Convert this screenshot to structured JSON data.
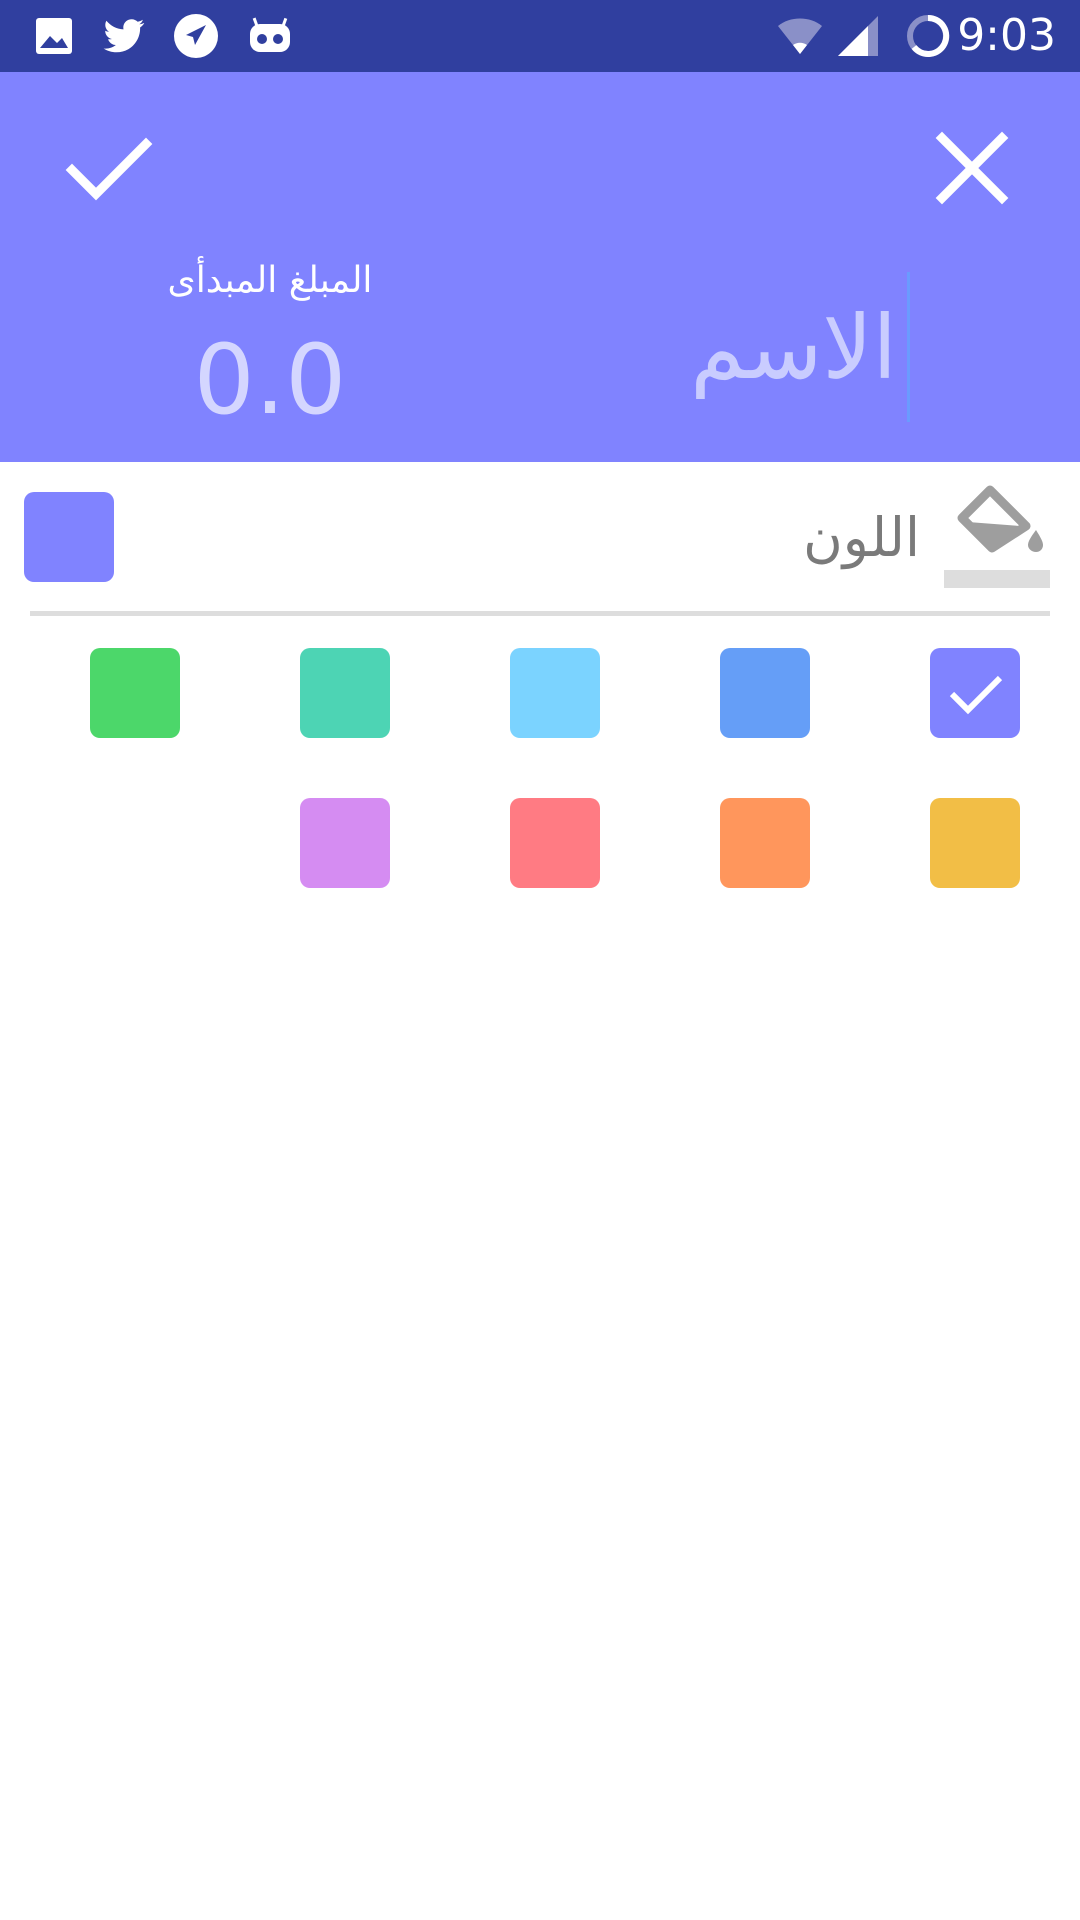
{
  "status_bar": {
    "time": "9:03",
    "left_icons": [
      "gallery-icon",
      "twitter-icon",
      "telegram-icon",
      "cyanogen-icon"
    ],
    "right_icons": [
      "wifi-icon",
      "signal-icon",
      "battery-ring-icon"
    ]
  },
  "header": {
    "confirm_icon": "check-icon",
    "close_icon": "close-icon",
    "amount_label": "المبلغ المبدأى",
    "amount_value": "0.0",
    "name_placeholder": "الاسم",
    "name_value": ""
  },
  "color_picker": {
    "label": "اللون",
    "icon": "paint-bucket-icon",
    "selected_color": "#8083ff",
    "swatches_row1": [
      {
        "color": "#4cd76a",
        "selected": false
      },
      {
        "color": "#4dd4b4",
        "selected": false
      },
      {
        "color": "#7bd3ff",
        "selected": false
      },
      {
        "color": "#659ef7",
        "selected": false
      },
      {
        "color": "#8083ff",
        "selected": true
      }
    ],
    "swatches_row2": [
      {
        "color": "#d58cf2",
        "selected": false
      },
      {
        "color": "#ff7b83",
        "selected": false
      },
      {
        "color": "#ff965c",
        "selected": false
      },
      {
        "color": "#f2be46",
        "selected": false
      }
    ]
  },
  "colors": {
    "status_bar": "#303f9f",
    "header": "#8083ff"
  }
}
